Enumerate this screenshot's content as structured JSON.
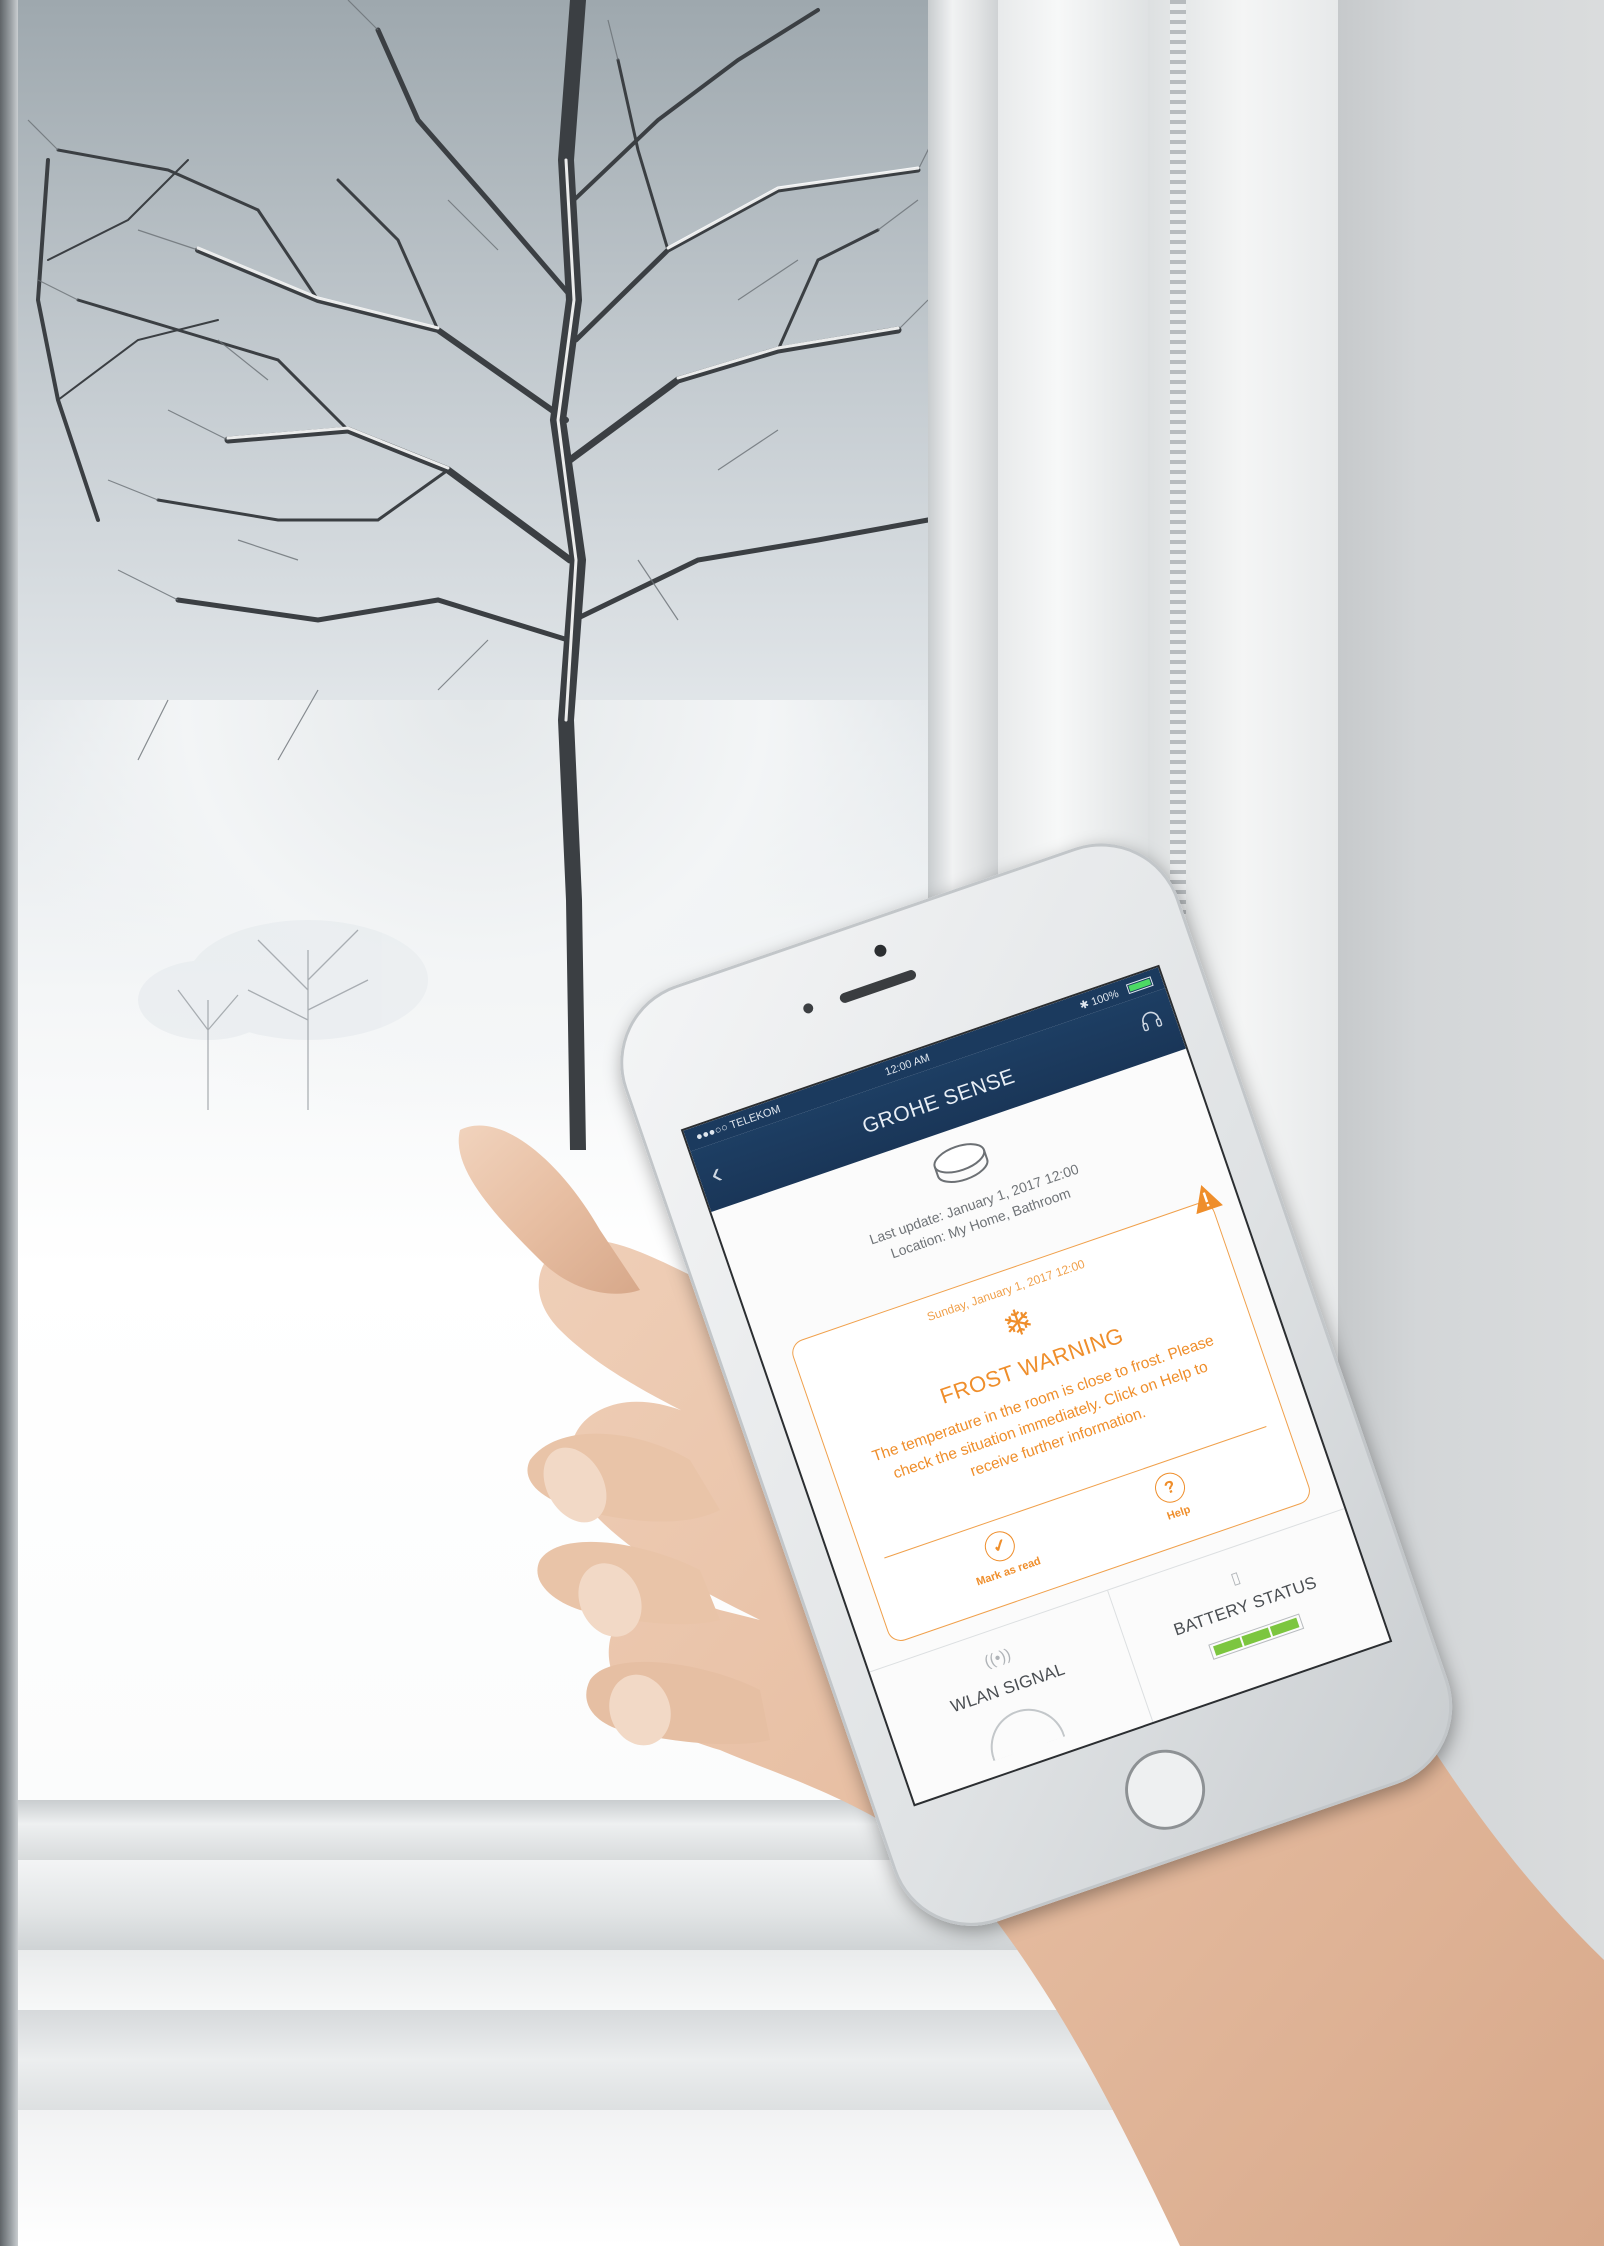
{
  "app": {
    "status_bar": {
      "carrier": "●●●○○ TELEKOM",
      "time": "12:00 AM",
      "battery_text": "✱ 100%",
      "battery_level": 1.0
    },
    "nav": {
      "title": "GROHE SENSE",
      "back_icon": "chevron-left-icon",
      "right_icon": "headset-icon"
    },
    "device": {
      "icon": "sensor-puck-icon",
      "last_update": "Last update: January 1, 2017 12:00",
      "location": "Location: My Home, Bathroom"
    },
    "notification": {
      "date": "Sunday, January 1, 2017 12:00",
      "icon": "snowflake-icon",
      "badge_icon": "warning-triangle-icon",
      "title": "FROST WARNING",
      "message": "The temperature in the room is close to frost. Please check the situation immediately. Click on Help to receive further information.",
      "actions": [
        {
          "label": "Mark as read",
          "icon": "check-circle-icon"
        },
        {
          "label": "Help",
          "icon": "question-circle-icon"
        }
      ]
    },
    "tiles": [
      {
        "label": "WLAN SIGNAL",
        "icon": "wifi-signal-icon"
      },
      {
        "label": "BATTERY STATUS",
        "icon": "battery-icon",
        "segments_filled": 3,
        "segments_total": 3
      }
    ],
    "colors": {
      "accent": "#ef8e2b",
      "nav_background": "#1b3a5e",
      "battery_green": "#7cc63f"
    }
  }
}
